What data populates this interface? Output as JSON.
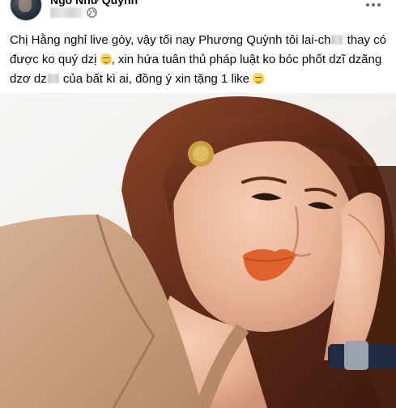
{
  "post": {
    "author_name": "Ngô Như Quỳnh",
    "privacy_icon": "globe-icon",
    "more_icon": "more-options-icon",
    "text_line_1_a": "Chị Hằng nghỉ live gòy, vậy tối nay Phương Quỳnh tôi lai-ch",
    "text_line_1_b": " thay có",
    "text_line_2_a": "được ko quý dzị ",
    "text_line_2_b": ", xin hứa tuân thủ pháp luật ko bóc phốt dzĩ dzãng",
    "text_line_3_a": "dzơ dz",
    "text_line_3_b": " của bất kì ai, đồng ý xin tặng 1 like ",
    "emoji_1": "smirk-emoji",
    "emoji_2": "relieved-emoji"
  },
  "photo": {
    "subject": "woman-portrait",
    "colors": {
      "background": "#f5f3f1",
      "hair": "#6a3220",
      "skin": "#e9b9a0",
      "blazer": "#c9a07e",
      "lips": "#e0622c",
      "earring": "#c9a040",
      "watch_strap": "#1f2a44"
    }
  }
}
